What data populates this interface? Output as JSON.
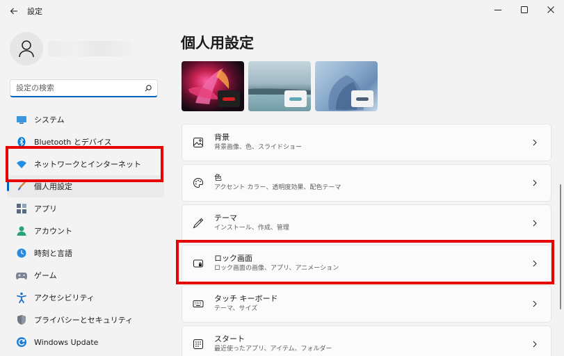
{
  "window": {
    "title": "設定",
    "controls": [
      "minimize",
      "maximize",
      "close"
    ]
  },
  "colors": {
    "accent": "#0067c0",
    "highlight": "#e60000",
    "background": "#f3f3f3",
    "card": "#fbfbfb"
  },
  "sidebar": {
    "search_placeholder": "設定の検索",
    "items": [
      {
        "label": "システム",
        "icon": "display-icon"
      },
      {
        "label": "Bluetooth とデバイス",
        "icon": "bluetooth-icon"
      },
      {
        "label": "ネットワークとインターネット",
        "icon": "wifi-icon"
      },
      {
        "label": "個人用設定",
        "icon": "brush-icon",
        "active": true
      },
      {
        "label": "アプリ",
        "icon": "apps-icon"
      },
      {
        "label": "アカウント",
        "icon": "account-icon"
      },
      {
        "label": "時刻と言語",
        "icon": "clock-globe-icon"
      },
      {
        "label": "ゲーム",
        "icon": "gamepad-icon"
      },
      {
        "label": "アクセシビリティ",
        "icon": "accessibility-icon"
      },
      {
        "label": "プライバシーとセキュリティ",
        "icon": "shield-icon"
      },
      {
        "label": "Windows Update",
        "icon": "update-icon"
      }
    ]
  },
  "main": {
    "title": "個人用設定",
    "themes": [
      {
        "name": "theme-glow",
        "chip_color": "#d81e1e"
      },
      {
        "name": "theme-captured-motion",
        "chip_color": "#5fa8b8"
      },
      {
        "name": "theme-bloom",
        "chip_color": "#4c5f78"
      }
    ],
    "cards": [
      {
        "title": "背景",
        "subtitle": "背景画像、色、スライドショー",
        "icon": "picture-icon"
      },
      {
        "title": "色",
        "subtitle": "アクセント カラー、透明度効果、配色テーマ",
        "icon": "palette-icon"
      },
      {
        "title": "テーマ",
        "subtitle": "インストール、作成、管理",
        "icon": "pen-icon"
      },
      {
        "title": "ロック画面",
        "subtitle": "ロック画面の画像、アプリ、アニメーション",
        "icon": "lock-screen-icon"
      },
      {
        "title": "タッチ キーボード",
        "subtitle": "テーマ、サイズ",
        "icon": "keyboard-icon"
      },
      {
        "title": "スタート",
        "subtitle": "最近使ったアプリ、アイテム、フォルダー",
        "icon": "start-icon"
      }
    ]
  }
}
